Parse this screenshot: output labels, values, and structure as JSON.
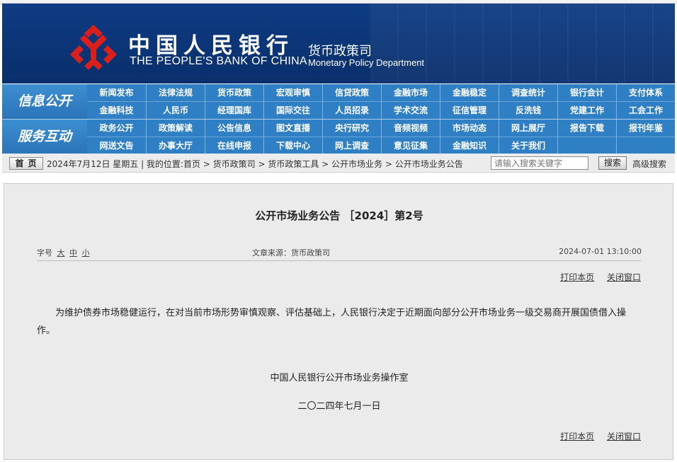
{
  "header": {
    "bank_name_cn": "中国人民银行",
    "bank_name_en": "THE PEOPLE'S BANK OF CHINA",
    "dept_cn": "货币政策司",
    "dept_en": "Monetary Policy Department",
    "logo_icon": "pboc-logo-icon"
  },
  "nav": {
    "block1_title": "信息公开",
    "block1_row1": [
      "新闻发布",
      "法律法规",
      "货币政策",
      "宏观审慎",
      "信贷政策",
      "金融市场",
      "金融稳定",
      "调查统计",
      "银行会计",
      "支付体系"
    ],
    "block1_row2": [
      "金融科技",
      "人民币",
      "经理国库",
      "国际交往",
      "人员招录",
      "学术交流",
      "征信管理",
      "反洗钱",
      "党建工作",
      "工会工作"
    ],
    "block2_title": "服务互动",
    "block2_row1": [
      "政务公开",
      "政策解读",
      "公告信息",
      "图文直播",
      "央行研究",
      "音频视频",
      "市场动态",
      "网上展厅",
      "报告下载",
      "报刊年鉴"
    ],
    "block2_row2": [
      "网送文告",
      "办事大厅",
      "在线申报",
      "下载中心",
      "网上调查",
      "意见征集",
      "金融知识",
      "关于我们",
      "",
      ""
    ]
  },
  "crumb": {
    "home_label": "首页",
    "text": "2024年7月12日 星期五 | 我的位置:首页 > 货币政策司 > 货币政策工具 > 公开市场业务 > 公开市场业务公告",
    "search_placeholder": "请输入搜索关键字",
    "search_button": "搜索",
    "advanced_search": "高级搜索"
  },
  "article": {
    "title": "公开市场业务公告 ［2024］第2号",
    "font_size_label": "字号",
    "font_large": "大",
    "font_medium": "中",
    "font_small": "小",
    "source": "文章来源：货币政策司",
    "date": "2024-07-01 13:10:00",
    "print_label": "打印本页",
    "close_label": "关闭窗口",
    "body": "为维护债券市场稳健运行，在对当前市场形势审慎观察、评估基础上，人民银行决定于近期面向部分公开市场业务一级交易商开展国债借入操作。",
    "signature_org": "中国人民银行公开市场业务操作室",
    "signature_date": "二〇二四年七月一日"
  }
}
